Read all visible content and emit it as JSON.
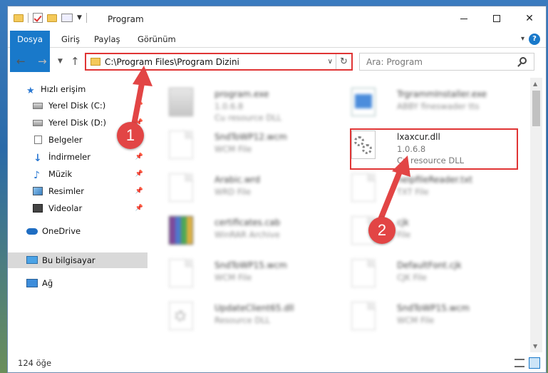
{
  "window": {
    "title": "Program"
  },
  "ribbon": {
    "file": "Dosya",
    "tabs": [
      "Giriş",
      "Paylaş",
      "Görünüm"
    ]
  },
  "address": {
    "path": "C:\\Program Files\\Program Dizini"
  },
  "search": {
    "placeholder": "Ara: Program"
  },
  "sidebar": {
    "items": [
      {
        "label": "Hızlı erişim",
        "icon": "star-icon",
        "pinned": false
      },
      {
        "label": "Yerel Disk (C:)",
        "icon": "disk-icon",
        "pinned": true
      },
      {
        "label": "Yerel Disk (D:)",
        "icon": "disk-icon",
        "pinned": true
      },
      {
        "label": "Belgeler",
        "icon": "document-icon",
        "pinned": true
      },
      {
        "label": "İndirmeler",
        "icon": "download-icon",
        "pinned": true
      },
      {
        "label": "Müzik",
        "icon": "music-icon",
        "pinned": true
      },
      {
        "label": "Resimler",
        "icon": "pictures-icon",
        "pinned": true
      },
      {
        "label": "Videolar",
        "icon": "videos-icon",
        "pinned": true
      },
      {
        "label": "OneDrive",
        "icon": "cloud-icon",
        "pinned": false
      },
      {
        "label": "Bu bilgisayar",
        "icon": "computer-icon",
        "pinned": false
      },
      {
        "label": "Ağ",
        "icon": "network-icon",
        "pinned": false
      }
    ]
  },
  "files": {
    "left": [
      {
        "name": "program.exe",
        "line1": "1.0.6.8",
        "line2": "Cu resource DLL",
        "icon": "exe-icon"
      },
      {
        "name": "SndToWP12.wcm",
        "line1": "WCM File",
        "line2": "",
        "icon": "file-icon"
      },
      {
        "name": "Arabic.wrd",
        "line1": "WRD File",
        "line2": "",
        "icon": "file-icon"
      },
      {
        "name": "certificates.cab",
        "line1": "WinRAR Archive",
        "line2": "",
        "icon": "archive-icon"
      },
      {
        "name": "SndToWP15.wcm",
        "line1": "WCM File",
        "line2": "",
        "icon": "file-icon"
      },
      {
        "name": "UpdateClient65.dll",
        "line1": "Resource DLL",
        "line2": "",
        "icon": "dll-icon"
      }
    ],
    "right": [
      {
        "name": "TrgrammInstaller.exe",
        "line1": "ABBY fineswader tts",
        "line2": "",
        "icon": "installer-icon"
      },
      {
        "name": "lxaxcur.dll",
        "line1": "1.0.6.8",
        "line2": "Cu resource DLL",
        "icon": "dll-icon"
      },
      {
        "name": "helpfileReader.txt",
        "line1": "TXT File",
        "line2": "",
        "icon": "file-icon"
      },
      {
        "name": "cjk",
        "line1": "File",
        "line2": "",
        "icon": "file-icon"
      },
      {
        "name": "DefaultFont.cjk",
        "line1": "CJK File",
        "line2": "",
        "icon": "file-icon"
      },
      {
        "name": "SndToWP15.wcm",
        "line1": "WCM File",
        "line2": "",
        "icon": "file-icon"
      }
    ]
  },
  "status": {
    "count": "124 öğe"
  },
  "annotations": {
    "step1": "1",
    "step2": "2",
    "color": "#e24545"
  }
}
